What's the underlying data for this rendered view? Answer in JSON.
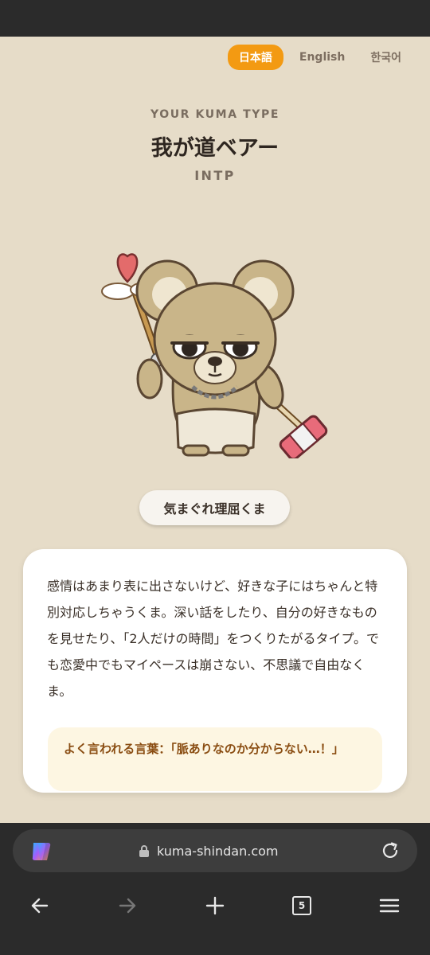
{
  "languages": [
    {
      "label": "日本語",
      "active": true
    },
    {
      "label": "English",
      "active": false
    },
    {
      "label": "한국어",
      "active": false
    }
  ],
  "result": {
    "kicker": "YOUR KUMA TYPE",
    "type_name": "我が道ベアー",
    "type_code": "INTP",
    "nickname": "気まぐれ理屈くま",
    "description": "感情はあまり表に出さないけど、好きな子にはちゃんと特別対応しちゃうくま。深い話をしたり、自分の好きなものを見せたり、「2人だけの時間」をつくりたがるタイプ。でも恋愛中でもマイペースは崩さない、不思議で自由なくま。",
    "quote": "よく言われる言葉：「脈ありなのか分からない…！」"
  },
  "colors": {
    "page_bg": "#e6dcc8",
    "accent": "#f39a12",
    "quote_text": "#8a4d12",
    "quote_bg": "#fdf6e2"
  },
  "browser": {
    "url": "kuma-shindan.com",
    "tab_count": "5",
    "icons": [
      "copilot-icon",
      "lock-icon",
      "reload-icon",
      "back-arrow-icon",
      "forward-arrow-icon",
      "plus-icon",
      "tabs-icon",
      "menu-icon"
    ]
  }
}
